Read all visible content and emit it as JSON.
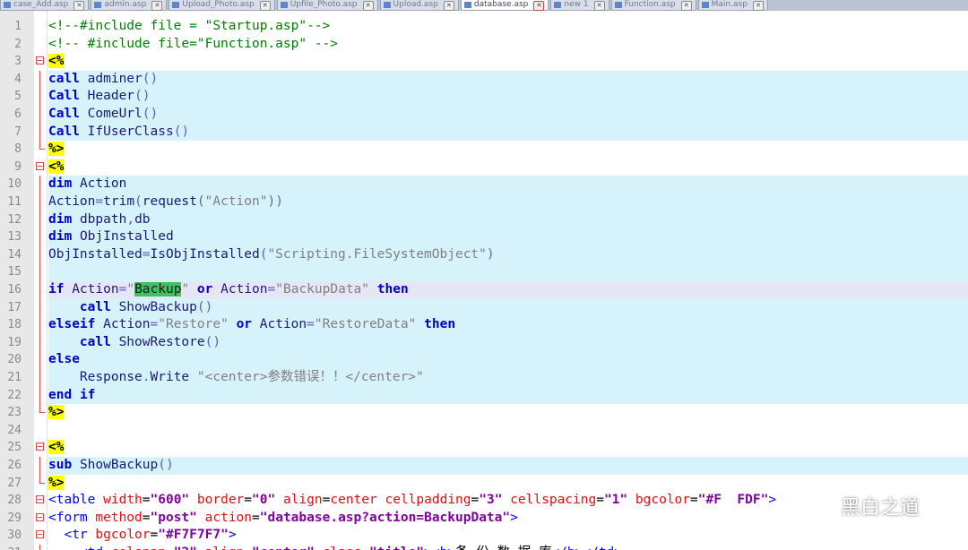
{
  "tabs": [
    {
      "label": "case_Add.asp",
      "active": false
    },
    {
      "label": "admin.asp",
      "active": false
    },
    {
      "label": "Upload_Photo.asp",
      "active": false
    },
    {
      "label": "Upfile_Photo.asp",
      "active": false
    },
    {
      "label": "Upload.asp",
      "active": false
    },
    {
      "label": "database.asp",
      "active": true
    },
    {
      "label": "new 1",
      "active": false
    },
    {
      "label": "Function.asp",
      "active": false
    },
    {
      "label": "Main.asp",
      "active": false
    }
  ],
  "code_lines": [
    {
      "n": "1",
      "bg": "none",
      "fold": "",
      "tokens": [
        [
          "cmt",
          "<!--#include file = \"Startup.asp\"-->"
        ]
      ]
    },
    {
      "n": "2",
      "bg": "none",
      "fold": "",
      "tokens": [
        [
          "cmt",
          "<!-- #include file=\"Function.asp\" -->"
        ]
      ]
    },
    {
      "n": "3",
      "bg": "none",
      "fold": "box",
      "tokens": [
        [
          "asp",
          "<%"
        ]
      ]
    },
    {
      "n": "4",
      "bg": "script",
      "fold": "vline",
      "tokens": [
        [
          "kw",
          "call"
        ],
        [
          "txt",
          " "
        ],
        [
          "fn",
          "adminer"
        ],
        [
          "op",
          "()"
        ]
      ]
    },
    {
      "n": "5",
      "bg": "script",
      "fold": "vline",
      "tokens": [
        [
          "kw",
          "Call"
        ],
        [
          "txt",
          " "
        ],
        [
          "fn",
          "Header"
        ],
        [
          "op",
          "()"
        ]
      ]
    },
    {
      "n": "6",
      "bg": "script",
      "fold": "vline",
      "tokens": [
        [
          "kw",
          "Call"
        ],
        [
          "txt",
          " "
        ],
        [
          "fn",
          "ComeUrl"
        ],
        [
          "op",
          "()"
        ]
      ]
    },
    {
      "n": "7",
      "bg": "script",
      "fold": "vline",
      "tokens": [
        [
          "kw",
          "Call"
        ],
        [
          "txt",
          " "
        ],
        [
          "fn",
          "IfUserClass"
        ],
        [
          "op",
          "()"
        ]
      ]
    },
    {
      "n": "8",
      "bg": "none",
      "fold": "corner",
      "tokens": [
        [
          "asp",
          "%>"
        ]
      ]
    },
    {
      "n": "9",
      "bg": "none",
      "fold": "box",
      "tokens": [
        [
          "asp",
          "<%"
        ]
      ]
    },
    {
      "n": "10",
      "bg": "script",
      "fold": "vline",
      "tokens": [
        [
          "kw",
          "dim"
        ],
        [
          "txt",
          " "
        ],
        [
          "fn",
          "Action"
        ]
      ]
    },
    {
      "n": "11",
      "bg": "script",
      "fold": "vline",
      "tokens": [
        [
          "fn",
          "Action"
        ],
        [
          "op",
          "="
        ],
        [
          "fn",
          "trim"
        ],
        [
          "op",
          "("
        ],
        [
          "fn",
          "request"
        ],
        [
          "op",
          "("
        ],
        [
          "str",
          "\"Action\""
        ],
        [
          "op",
          "))"
        ]
      ]
    },
    {
      "n": "12",
      "bg": "script",
      "fold": "vline",
      "tokens": [
        [
          "kw",
          "dim"
        ],
        [
          "txt",
          " "
        ],
        [
          "fn",
          "dbpath"
        ],
        [
          "op",
          ","
        ],
        [
          "fn",
          "db"
        ]
      ]
    },
    {
      "n": "13",
      "bg": "script",
      "fold": "vline",
      "tokens": [
        [
          "kw",
          "dim"
        ],
        [
          "txt",
          " "
        ],
        [
          "fn",
          "ObjInstalled"
        ]
      ]
    },
    {
      "n": "14",
      "bg": "script",
      "fold": "vline",
      "tokens": [
        [
          "fn",
          "ObjInstalled"
        ],
        [
          "op",
          "="
        ],
        [
          "fn",
          "IsObjInstalled"
        ],
        [
          "op",
          "("
        ],
        [
          "str",
          "\"Scripting.FileSystemObject\""
        ],
        [
          "op",
          ")"
        ]
      ]
    },
    {
      "n": "15",
      "bg": "script",
      "fold": "vline",
      "tokens": []
    },
    {
      "n": "16",
      "bg": "caret",
      "fold": "vline",
      "tokens": [
        [
          "kw",
          "if"
        ],
        [
          "txt",
          " "
        ],
        [
          "fn",
          "Action"
        ],
        [
          "op",
          "="
        ],
        [
          "str",
          "\""
        ],
        [
          "hl",
          "Backup"
        ],
        [
          "str",
          "\""
        ],
        [
          "txt",
          " "
        ],
        [
          "kw",
          "or"
        ],
        [
          "txt",
          " "
        ],
        [
          "fn",
          "Action"
        ],
        [
          "op",
          "="
        ],
        [
          "str",
          "\"BackupData\""
        ],
        [
          "txt",
          " "
        ],
        [
          "kw",
          "then"
        ]
      ]
    },
    {
      "n": "17",
      "bg": "script",
      "fold": "vline",
      "tokens": [
        [
          "txt",
          "    "
        ],
        [
          "kw",
          "call"
        ],
        [
          "txt",
          " "
        ],
        [
          "fn",
          "ShowBackup"
        ],
        [
          "op",
          "()"
        ]
      ]
    },
    {
      "n": "18",
      "bg": "script",
      "fold": "vline",
      "tokens": [
        [
          "kw",
          "elseif"
        ],
        [
          "txt",
          " "
        ],
        [
          "fn",
          "Action"
        ],
        [
          "op",
          "="
        ],
        [
          "str",
          "\"Restore\""
        ],
        [
          "txt",
          " "
        ],
        [
          "kw",
          "or"
        ],
        [
          "txt",
          " "
        ],
        [
          "fn",
          "Action"
        ],
        [
          "op",
          "="
        ],
        [
          "str",
          "\"RestoreData\""
        ],
        [
          "txt",
          " "
        ],
        [
          "kw",
          "then"
        ]
      ]
    },
    {
      "n": "19",
      "bg": "script",
      "fold": "vline",
      "tokens": [
        [
          "txt",
          "    "
        ],
        [
          "kw",
          "call"
        ],
        [
          "txt",
          " "
        ],
        [
          "fn",
          "ShowRestore"
        ],
        [
          "op",
          "()"
        ]
      ]
    },
    {
      "n": "20",
      "bg": "script",
      "fold": "vline",
      "tokens": [
        [
          "kw",
          "else"
        ]
      ]
    },
    {
      "n": "21",
      "bg": "script",
      "fold": "vline",
      "tokens": [
        [
          "txt",
          "    "
        ],
        [
          "fn",
          "Response"
        ],
        [
          "op",
          "."
        ],
        [
          "fn",
          "Write"
        ],
        [
          "txt",
          " "
        ],
        [
          "str",
          "\"<center>参数错误！！</center>\""
        ]
      ]
    },
    {
      "n": "22",
      "bg": "script",
      "fold": "vline",
      "tokens": [
        [
          "kw",
          "end"
        ],
        [
          "txt",
          " "
        ],
        [
          "kw",
          "if"
        ]
      ]
    },
    {
      "n": "23",
      "bg": "none",
      "fold": "corner",
      "tokens": [
        [
          "asp",
          "%>"
        ]
      ]
    },
    {
      "n": "24",
      "bg": "none",
      "fold": "",
      "tokens": []
    },
    {
      "n": "25",
      "bg": "none",
      "fold": "box",
      "tokens": [
        [
          "asp",
          "<%"
        ]
      ]
    },
    {
      "n": "26",
      "bg": "script",
      "fold": "vline",
      "tokens": [
        [
          "kw",
          "sub"
        ],
        [
          "txt",
          " "
        ],
        [
          "fn",
          "ShowBackup"
        ],
        [
          "op",
          "()"
        ]
      ]
    },
    {
      "n": "27",
      "bg": "none",
      "fold": "corner",
      "tokens": [
        [
          "asp",
          "%>"
        ]
      ]
    },
    {
      "n": "28",
      "bg": "none",
      "fold": "box",
      "tokens": [
        [
          "tag",
          "<table"
        ],
        [
          "txt",
          " "
        ],
        [
          "attr",
          "width"
        ],
        [
          "txt",
          "="
        ],
        [
          "val",
          "\"600\""
        ],
        [
          "txt",
          " "
        ],
        [
          "attr",
          "border"
        ],
        [
          "txt",
          "="
        ],
        [
          "val",
          "\"0\""
        ],
        [
          "txt",
          " "
        ],
        [
          "attr",
          "align"
        ],
        [
          "txt",
          "="
        ],
        [
          "attr",
          "center"
        ],
        [
          "txt",
          " "
        ],
        [
          "attr",
          "cellpadding"
        ],
        [
          "txt",
          "="
        ],
        [
          "val",
          "\"3\""
        ],
        [
          "txt",
          " "
        ],
        [
          "attr",
          "cellspacing"
        ],
        [
          "txt",
          "="
        ],
        [
          "val",
          "\"1\""
        ],
        [
          "txt",
          " "
        ],
        [
          "attr",
          "bgcolor"
        ],
        [
          "txt",
          "="
        ],
        [
          "val",
          "\"#F  FDF\""
        ],
        [
          "tag",
          ">"
        ]
      ]
    },
    {
      "n": "29",
      "bg": "none",
      "fold": "box",
      "tokens": [
        [
          "tag",
          "<form"
        ],
        [
          "txt",
          " "
        ],
        [
          "attr",
          "method"
        ],
        [
          "txt",
          "="
        ],
        [
          "val",
          "\"post\""
        ],
        [
          "txt",
          " "
        ],
        [
          "attr",
          "action"
        ],
        [
          "txt",
          "="
        ],
        [
          "val",
          "\"database.asp?action=BackupData\""
        ],
        [
          "tag",
          ">"
        ]
      ]
    },
    {
      "n": "30",
      "bg": "none",
      "fold": "box",
      "tokens": [
        [
          "txt",
          "  "
        ],
        [
          "tag",
          "<tr"
        ],
        [
          "txt",
          " "
        ],
        [
          "attr",
          "bgcolor"
        ],
        [
          "txt",
          "="
        ],
        [
          "val",
          "\"#F7F7F7\""
        ],
        [
          "tag",
          ">"
        ]
      ]
    },
    {
      "n": "31",
      "bg": "none",
      "fold": "vline",
      "tokens": [
        [
          "txt",
          "    "
        ],
        [
          "tag",
          "<td"
        ],
        [
          "txt",
          " "
        ],
        [
          "attr",
          "colspan"
        ],
        [
          "txt",
          "="
        ],
        [
          "val",
          "\"2\""
        ],
        [
          "txt",
          " "
        ],
        [
          "attr",
          "align"
        ],
        [
          "txt",
          "="
        ],
        [
          "val",
          "\"center\""
        ],
        [
          "txt",
          " "
        ],
        [
          "attr",
          "class"
        ],
        [
          "txt",
          "="
        ],
        [
          "val",
          "\"title\""
        ],
        [
          "tag",
          "><b>"
        ],
        [
          "txt",
          "备 份 数 据 库"
        ],
        [
          "tag",
          "</b></td>"
        ]
      ]
    }
  ],
  "watermark": {
    "text": "黑白之道",
    "icon": "wechat-icon"
  }
}
